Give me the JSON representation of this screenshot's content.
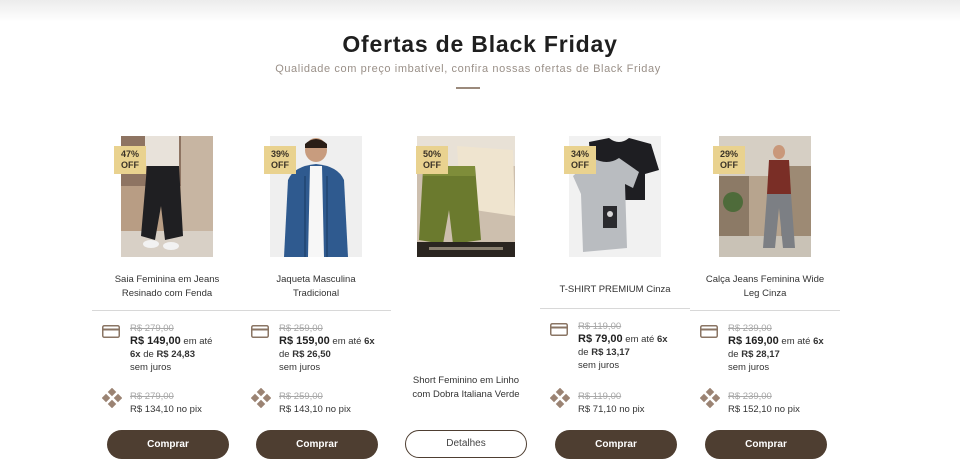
{
  "header": {
    "title": "Ofertas de Black Friday",
    "subtitle": "Qualidade com preço imbatível, confira nossas ofertas de Black Friday"
  },
  "colors": {
    "badge": "#e9d28f",
    "button": "#4e3e31",
    "divider": "#9b8a7c"
  },
  "products": [
    {
      "discount": "47%",
      "discount_suffix": "OFF",
      "name_line1": "Saia Feminina em Jeans",
      "name_line2": "Resinado com Fenda",
      "card_old_price": "R$ 279,00",
      "card_price": "R$ 149,00",
      "card_text1": " em até",
      "installments": "6x",
      "card_text2": " de ",
      "installment_value": "R$ 24,83",
      "card_text3": "sem juros",
      "pix_old_price": "R$ 279,00",
      "pix_text": "R$ 134,10 no pix",
      "button_label": "Comprar"
    },
    {
      "discount": "39%",
      "discount_suffix": "OFF",
      "name_line1": "Jaqueta Masculina",
      "name_line2": "Tradicional",
      "card_old_price": "R$ 259,00",
      "card_price": "R$ 159,00",
      "card_text1": " em até ",
      "installments": "6x",
      "card_text2": " de ",
      "installment_value": "R$ 26,50",
      "card_text3": "sem juros",
      "pix_old_price": "R$ 259,00",
      "pix_text": "R$ 143,10 no pix",
      "button_label": "Comprar"
    },
    {
      "discount": "50%",
      "discount_suffix": "OFF",
      "name_line1": "Short Feminino em Linho",
      "name_line2": "com Dobra Italiana Verde",
      "button_label": "Detalhes"
    },
    {
      "discount": "34%",
      "discount_suffix": "OFF",
      "name_line1": "T-SHIRT PREMIUM Cinza",
      "card_old_price": "R$ 119,00",
      "card_price": "R$ 79,00",
      "card_text1": " em até ",
      "installments": "6x",
      "card_text2": " de ",
      "installment_value": "R$ 13,17",
      "card_text3": "sem juros",
      "pix_old_price": "R$ 119,00",
      "pix_text": "R$ 71,10 no pix",
      "button_label": "Comprar"
    },
    {
      "discount": "29%",
      "discount_suffix": "OFF",
      "name_line1": "Calça Jeans Feminina Wide",
      "name_line2": "Leg Cinza",
      "card_old_price": "R$ 239,00",
      "card_price": "R$ 169,00",
      "card_text1": " em até ",
      "installments": "6x",
      "card_text2": " de ",
      "installment_value": "R$ 28,17",
      "card_text3": "sem juros",
      "pix_old_price": "R$ 239,00",
      "pix_text": "R$ 152,10 no pix",
      "button_label": "Comprar"
    }
  ]
}
